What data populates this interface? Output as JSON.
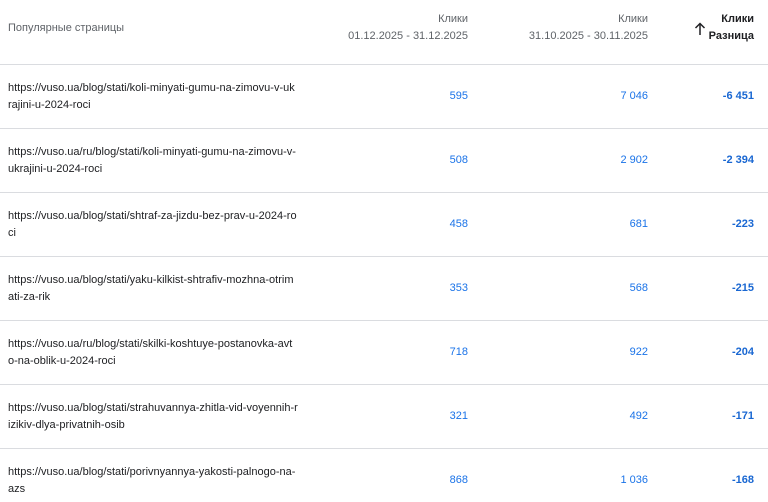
{
  "header": {
    "pages_label": "Популярные страницы",
    "col1": {
      "title": "Клики",
      "range": "01.12.2025 - 31.12.2025"
    },
    "col2": {
      "title": "Клики",
      "range": "31.10.2025 - 30.11.2025"
    },
    "col3": {
      "title": "Клики",
      "subtitle": "Разница"
    },
    "sort_icon": "arrow-up-icon"
  },
  "rows": [
    {
      "url": "https://vuso.ua/blog/stati/koli-minyati-gumu-na-zimovu-v-ukrajini-u-2024-roci",
      "current": "595",
      "previous": "7 046",
      "diff": "-6 451"
    },
    {
      "url": "https://vuso.ua/ru/blog/stati/koli-minyati-gumu-na-zimovu-v-ukrajini-u-2024-roci",
      "current": "508",
      "previous": "2 902",
      "diff": "-2 394"
    },
    {
      "url": "https://vuso.ua/blog/stati/shtraf-za-jizdu-bez-prav-u-2024-roci",
      "current": "458",
      "previous": "681",
      "diff": "-223"
    },
    {
      "url": "https://vuso.ua/blog/stati/yaku-kilkist-shtrafiv-mozhna-otrimati-za-rik",
      "current": "353",
      "previous": "568",
      "diff": "-215"
    },
    {
      "url": "https://vuso.ua/ru/blog/stati/skilki-koshtuye-postanovka-avto-na-oblik-u-2024-roci",
      "current": "718",
      "previous": "922",
      "diff": "-204"
    },
    {
      "url": "https://vuso.ua/blog/stati/strahuvannya-zhitla-vid-voyennih-rizikiv-dlya-privatnih-osib",
      "current": "321",
      "previous": "492",
      "diff": "-171"
    },
    {
      "url": "https://vuso.ua/blog/stati/porivnyannya-yakosti-palnogo-na-azs",
      "current": "868",
      "previous": "1 036",
      "diff": "-168"
    }
  ]
}
